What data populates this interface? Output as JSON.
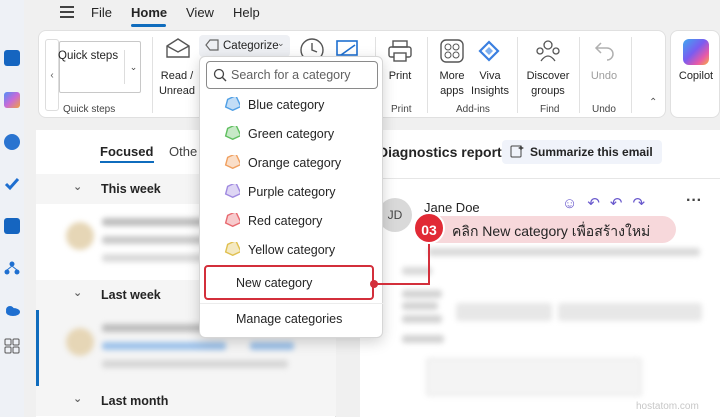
{
  "menu": {
    "items": [
      "File",
      "Home",
      "View",
      "Help"
    ],
    "active": "Home"
  },
  "ribbon": {
    "quick_steps_input": "Quick steps",
    "quick_steps_group": "Quick steps",
    "categorize_label": "Categorize",
    "read_unread": [
      "Read /",
      "Unread"
    ],
    "print_label": "Print",
    "print_group": "Print",
    "more_apps": [
      "More",
      "apps"
    ],
    "viva_insights": [
      "Viva",
      "Insights"
    ],
    "addins_group": "Add-ins",
    "discover_groups": [
      "Discover",
      "groups"
    ],
    "find_group": "Find",
    "undo_label": "Undo",
    "undo_group": "Undo",
    "copilot_label": "Copilot"
  },
  "mail_list": {
    "tab_focused": "Focused",
    "tab_other": "Othe",
    "group_this_week": "This week",
    "group_last_week": "Last week",
    "group_last_month": "Last month"
  },
  "reading_pane": {
    "title": "Diagnostics report",
    "summarize": "Summarize this email",
    "avatar_initials": "JD",
    "sender": "Jane Doe"
  },
  "category_menu": {
    "search_placeholder": "Search for a category",
    "categories": [
      {
        "label": "Blue category",
        "color": "#4f9fe5"
      },
      {
        "label": "Green category",
        "color": "#5fbf5f"
      },
      {
        "label": "Orange category",
        "color": "#f0a060"
      },
      {
        "label": "Purple category",
        "color": "#a08ae0"
      },
      {
        "label": "Red category",
        "color": "#e86a70"
      },
      {
        "label": "Yellow category",
        "color": "#e0c050"
      }
    ],
    "new_category": "New category",
    "manage_categories": "Manage categories"
  },
  "annotation": {
    "step_number": "03",
    "text": "คลิก New category เพื่อสร้างใหม่"
  },
  "watermark": "hostatom.com"
}
